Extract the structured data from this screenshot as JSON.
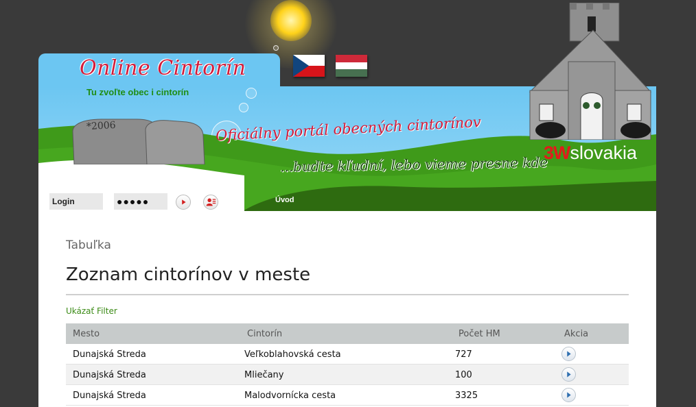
{
  "header": {
    "logo_title": "Online Cintorín",
    "logo_subtitle": "Tu zvoľte obec i cintorín",
    "tombstone_year": "*2006",
    "slogan_line1": "Oficiálny portál obecných cintorínov",
    "slogan_line2": "...budte kľudní, lebo vieme presne kde",
    "brand_3w": "3W",
    "brand_name": "slovakia",
    "flags": [
      "czech-flag",
      "hungarian-flag"
    ]
  },
  "login": {
    "username_value": "Login",
    "password_value": "●●●●●"
  },
  "nav": {
    "items": [
      "Úvod"
    ]
  },
  "main": {
    "breadcrumb": "Tabuľka",
    "title": "Zoznam cintorínov v meste",
    "filter_link": "Ukázať Filter",
    "table": {
      "columns": [
        "Mesto",
        "Cintorín",
        "Počet HM",
        "Akcia"
      ],
      "rows": [
        [
          "Dunajská Streda",
          "Veľkoblahovská cesta",
          "727"
        ],
        [
          "Dunajská Streda",
          "Mliečany",
          "100"
        ],
        [
          "Dunajská Streda",
          "Malodvornícka cesta",
          "3325"
        ]
      ]
    }
  },
  "colors": {
    "background": "#3a3a3a",
    "sky": "#6cc6f2",
    "grass": "#3f9a1a",
    "dark_grass": "#2e6b10",
    "logo_red": "#d21b3a",
    "link_green": "#3a8a14"
  }
}
